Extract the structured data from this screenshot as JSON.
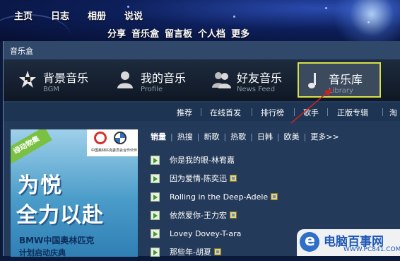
{
  "top_nav": {
    "primary": [
      "主页",
      "日志",
      "相册",
      "说说"
    ],
    "secondary": [
      "分享",
      "音乐盒",
      "留言板",
      "个人档",
      "更多"
    ]
  },
  "module": {
    "title": "音乐盒"
  },
  "tabs": [
    {
      "label": "背景音乐",
      "sub": "BGM",
      "icon": "star-music-icon"
    },
    {
      "label": "我的音乐",
      "sub": "Profile",
      "icon": "person-icon"
    },
    {
      "label": "好友音乐",
      "sub": "News Feed",
      "icon": "people-icon"
    },
    {
      "label": "音乐库",
      "sub": "Library",
      "icon": "music-note-icon",
      "active": true
    }
  ],
  "subnav": [
    "推荐",
    "在线首发",
    "排行榜",
    "歌手",
    "正版专辑",
    "淘"
  ],
  "banner": {
    "ribbon": "绿动物集",
    "line1": "为悦",
    "line2": "全力以赴",
    "line3": "BMW中国奥林匹克",
    "line4": "计划启动庆典",
    "caption": "中国奥林匹克委员会合作伙伴"
  },
  "filters": {
    "items": [
      "销量",
      "热搜",
      "新歌",
      "热歌",
      "日韩",
      "欧美",
      "更多>>"
    ],
    "active": "销量"
  },
  "songs": [
    {
      "title": "你是我的眼-林宥嘉",
      "badge": false
    },
    {
      "title": "因为爱情-陈奕迅",
      "badge": true
    },
    {
      "title": "Rolling in the Deep-Adele",
      "badge": true
    },
    {
      "title": "依然爱你-王力宏",
      "badge": true
    },
    {
      "title": "Lovey Dovey-T-ara",
      "badge": false
    },
    {
      "title": "那些年-胡夏",
      "badge": true
    }
  ],
  "watermark": {
    "name": "电脑百事网",
    "url": "WWW.PC841.COM"
  },
  "colors": {
    "active_tab_border": "#d8e046",
    "arrow": "#cc2222",
    "play": "#3c9a2e"
  }
}
